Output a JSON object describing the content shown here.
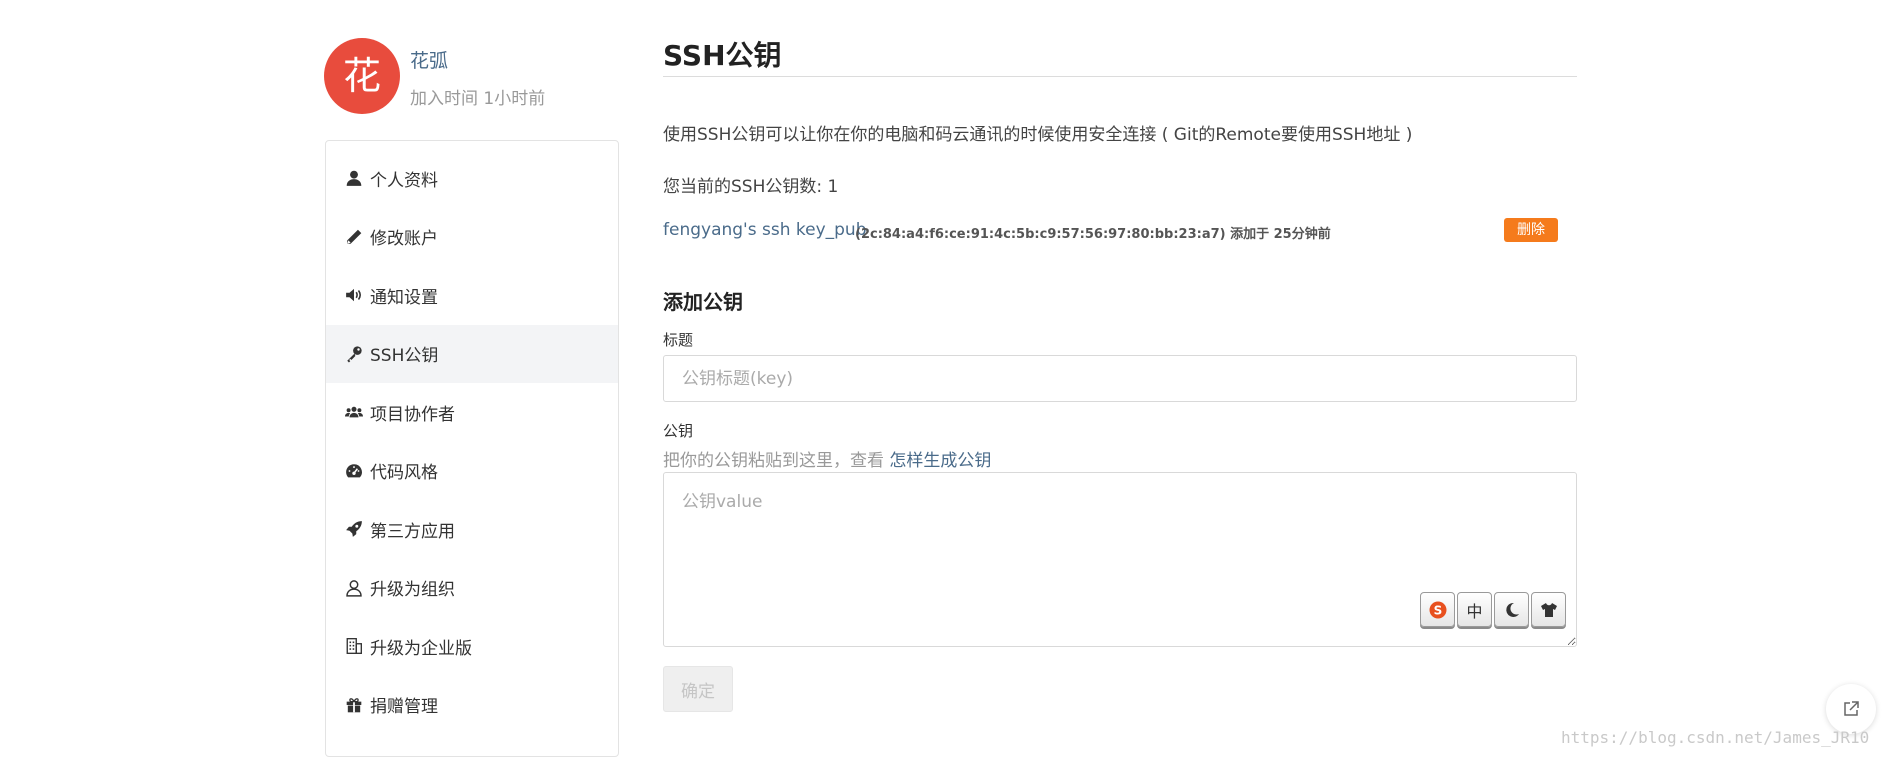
{
  "profile": {
    "avatar_char": "花",
    "name": "花弧",
    "joined": "加入时间 1小时前"
  },
  "sidebar": {
    "items": [
      {
        "label": "个人资料",
        "icon": "user-icon"
      },
      {
        "label": "修改账户",
        "icon": "pencil-icon"
      },
      {
        "label": "通知设置",
        "icon": "volume-icon"
      },
      {
        "label": "SSH公钥",
        "icon": "key-icon",
        "active": true
      },
      {
        "label": "项目协作者",
        "icon": "users-icon"
      },
      {
        "label": "代码风格",
        "icon": "dashboard-icon"
      },
      {
        "label": "第三方应用",
        "icon": "rocket-icon"
      },
      {
        "label": "升级为组织",
        "icon": "user-outline-icon"
      },
      {
        "label": "升级为企业版",
        "icon": "building-icon"
      },
      {
        "label": "捐赠管理",
        "icon": "gift-icon"
      }
    ]
  },
  "main": {
    "title": "SSH公钥",
    "description": "使用SSH公钥可以让你在你的电脑和码云通讯的时候使用安全连接 ( Git的Remote要使用SSH地址 )",
    "count_text": "您当前的SSH公钥数: 1",
    "keys": [
      {
        "name": "fengyang's ssh key_pub",
        "meta": "(2c:84:a4:f6:ce:91:4c:5b:c9:57:56:97:80:bb:23:a7) 添加于 25分钟前",
        "delete_label": "删除"
      }
    ],
    "add_section_title": "添加公钥",
    "title_field_label": "标题",
    "title_placeholder": "公钥标题(key)",
    "key_field_label": "公钥",
    "key_hint_prefix": "把你的公钥粘贴到这里，查看 ",
    "key_hint_link": "怎样生成公钥",
    "key_placeholder": "公钥value",
    "confirm_label": "确定"
  },
  "ime_toolbar": {
    "middle_char": "中"
  },
  "watermark": "https://blog.csdn.net/James_JR10",
  "colors": {
    "avatar_bg": "#e84c3d",
    "link": "#4a6b8a",
    "delete_button": "#f57b1c",
    "active_nav_bg": "#f3f4f6"
  }
}
